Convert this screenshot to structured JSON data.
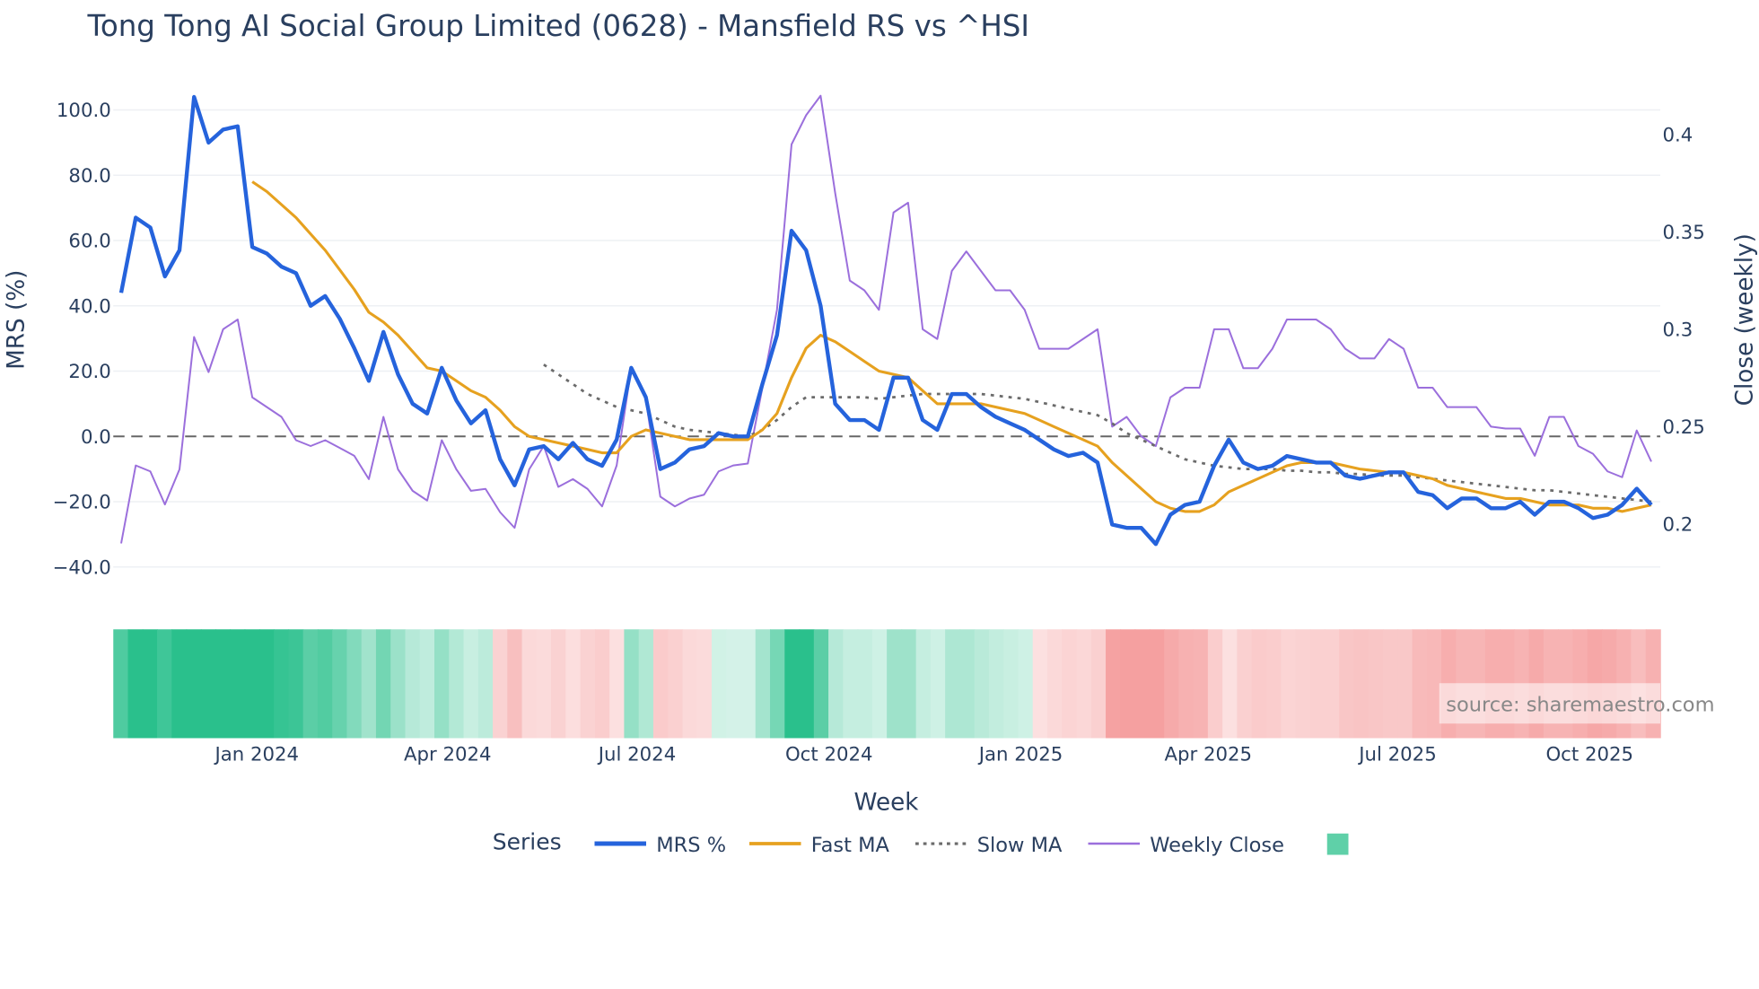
{
  "chart_data": {
    "type": "line",
    "title": "Tong Tong AI Social Group Limited (0628) - Mansfield RS vs ^HSI",
    "xlabel": "Week",
    "ylabel": "MRS (%)",
    "y2label": "Close (weekly)",
    "ylim": [
      -40,
      100
    ],
    "y2lim": [
      0.19,
      0.42
    ],
    "yticks": [
      "100.0",
      "80.0",
      "60.0",
      "40.0",
      "20.0",
      "0.0",
      "−20.0",
      "−40.0"
    ],
    "y2ticks": [
      "0.4",
      "0.35",
      "0.3",
      "0.25",
      "0.2"
    ],
    "xticks": [
      "Jan 2024",
      "Apr 2024",
      "Jul 2024",
      "Oct 2024",
      "Jan 2025",
      "Apr 2025",
      "Jul 2025",
      "Oct 2025"
    ],
    "reference_line": 0,
    "legend_title": "Series",
    "legend_position": "bottom",
    "source": "source: sharemaestro.com",
    "colors": {
      "mrs": "#2563dc",
      "fast": "#e6a11f",
      "slow": "#6b6b6b",
      "close": "#9b6fdc",
      "pos": "#2ac08c",
      "neg": "#f5a0a0"
    },
    "series": [
      {
        "name": "MRS %",
        "key": "mrs",
        "axis": "left",
        "start": 0,
        "values": [
          44,
          67,
          64,
          49,
          57,
          104,
          90,
          94,
          95,
          58,
          56,
          52,
          50,
          40,
          43,
          36,
          27,
          17,
          32,
          19,
          10,
          7,
          21,
          11,
          4,
          8,
          -7,
          -15,
          -4,
          -3,
          -7,
          -2,
          -7,
          -9,
          -1,
          21,
          12,
          -10,
          -8,
          -4,
          -3,
          1,
          0,
          0,
          16,
          31,
          63,
          57,
          40,
          10,
          5,
          5,
          2,
          18,
          18,
          5,
          2,
          13,
          13,
          9,
          6,
          4,
          2,
          -1,
          -4,
          -6,
          -5,
          -8,
          -27,
          -28,
          -28,
          -33,
          -24,
          -21,
          -20,
          -9,
          -1,
          -8,
          -10,
          -9,
          -6,
          -7,
          -8,
          -8,
          -12,
          -13,
          -12,
          -11,
          -11,
          -17,
          -18,
          -22,
          -19,
          -19,
          -22,
          -22,
          -20,
          -24,
          -20,
          -20,
          -22,
          -25,
          -24,
          -21,
          -16,
          -21
        ]
      },
      {
        "name": "Fast MA",
        "key": "fast",
        "axis": "left",
        "start": 9,
        "values": [
          78,
          75,
          71,
          67,
          62,
          57,
          51,
          45,
          38,
          35,
          31,
          26,
          21,
          20,
          17,
          14,
          12,
          8,
          3,
          0,
          -1,
          -2,
          -3,
          -4,
          -5,
          -5,
          0,
          2,
          1,
          0,
          -1,
          -1,
          -1,
          -1,
          -1,
          2,
          7,
          18,
          27,
          31,
          29,
          26,
          23,
          20,
          19,
          18,
          14,
          10,
          10,
          10,
          10,
          9,
          8,
          7,
          5,
          3,
          1,
          -1,
          -3,
          -8,
          -12,
          -16,
          -20,
          -22,
          -23,
          -23,
          -21,
          -17,
          -15,
          -13,
          -11,
          -9,
          -8,
          -8,
          -8,
          -9,
          -10,
          -10.5,
          -11,
          -11,
          -12,
          -13,
          -15,
          -16,
          -17,
          -18,
          -19,
          -19,
          -20,
          -21,
          -21,
          -21,
          -22,
          -22,
          -23,
          -22,
          -21
        ]
      },
      {
        "name": "Slow MA",
        "key": "slow",
        "axis": "left",
        "start": 29,
        "values": [
          22,
          19,
          16,
          13,
          11,
          9,
          8,
          7,
          5,
          3,
          2,
          1.5,
          1,
          0.5,
          0,
          2,
          5,
          9,
          12,
          12,
          12,
          12,
          12,
          11.5,
          12,
          12.5,
          13,
          13,
          13,
          13,
          13,
          12.5,
          12,
          11.5,
          10.5,
          9.5,
          8.5,
          7.5,
          6.5,
          4,
          1,
          -1,
          -3,
          -5,
          -7,
          -8,
          -9,
          -9.5,
          -10,
          -10,
          -10,
          -10.5,
          -10.5,
          -11,
          -11,
          -11.5,
          -11.5,
          -12,
          -12,
          -12,
          -12.5,
          -13,
          -13.5,
          -14,
          -14.5,
          -15,
          -15.5,
          -16,
          -16.5,
          -16.5,
          -17,
          -17.5,
          -18,
          -18.5,
          -19,
          -19.5,
          -20
        ]
      },
      {
        "name": "Weekly Close",
        "key": "close",
        "axis": "right",
        "start": 0,
        "values": [
          0.19,
          0.23,
          0.227,
          0.21,
          0.228,
          0.296,
          0.278,
          0.3,
          0.305,
          0.265,
          0.26,
          0.255,
          0.243,
          0.24,
          0.243,
          0.239,
          0.235,
          0.223,
          0.255,
          0.228,
          0.217,
          0.212,
          0.243,
          0.228,
          0.217,
          0.218,
          0.206,
          0.198,
          0.228,
          0.24,
          0.219,
          0.223,
          0.218,
          0.209,
          0.23,
          0.28,
          0.264,
          0.214,
          0.209,
          0.213,
          0.215,
          0.227,
          0.23,
          0.231,
          0.27,
          0.31,
          0.395,
          0.41,
          0.42,
          0.37,
          0.325,
          0.32,
          0.31,
          0.36,
          0.365,
          0.3,
          0.295,
          0.33,
          0.34,
          0.33,
          0.32,
          0.32,
          0.31,
          0.29,
          0.29,
          0.29,
          0.295,
          0.3,
          0.25,
          0.255,
          0.245,
          0.24,
          0.265,
          0.27,
          0.27,
          0.3,
          0.3,
          0.28,
          0.28,
          0.29,
          0.305,
          0.305,
          0.305,
          0.3,
          0.29,
          0.285,
          0.285,
          0.295,
          0.29,
          0.27,
          0.27,
          0.26,
          0.26,
          0.26,
          0.25,
          0.249,
          0.249,
          0.235,
          0.255,
          0.255,
          0.24,
          0.236,
          0.227,
          0.224,
          0.248,
          0.232
        ]
      }
    ]
  }
}
